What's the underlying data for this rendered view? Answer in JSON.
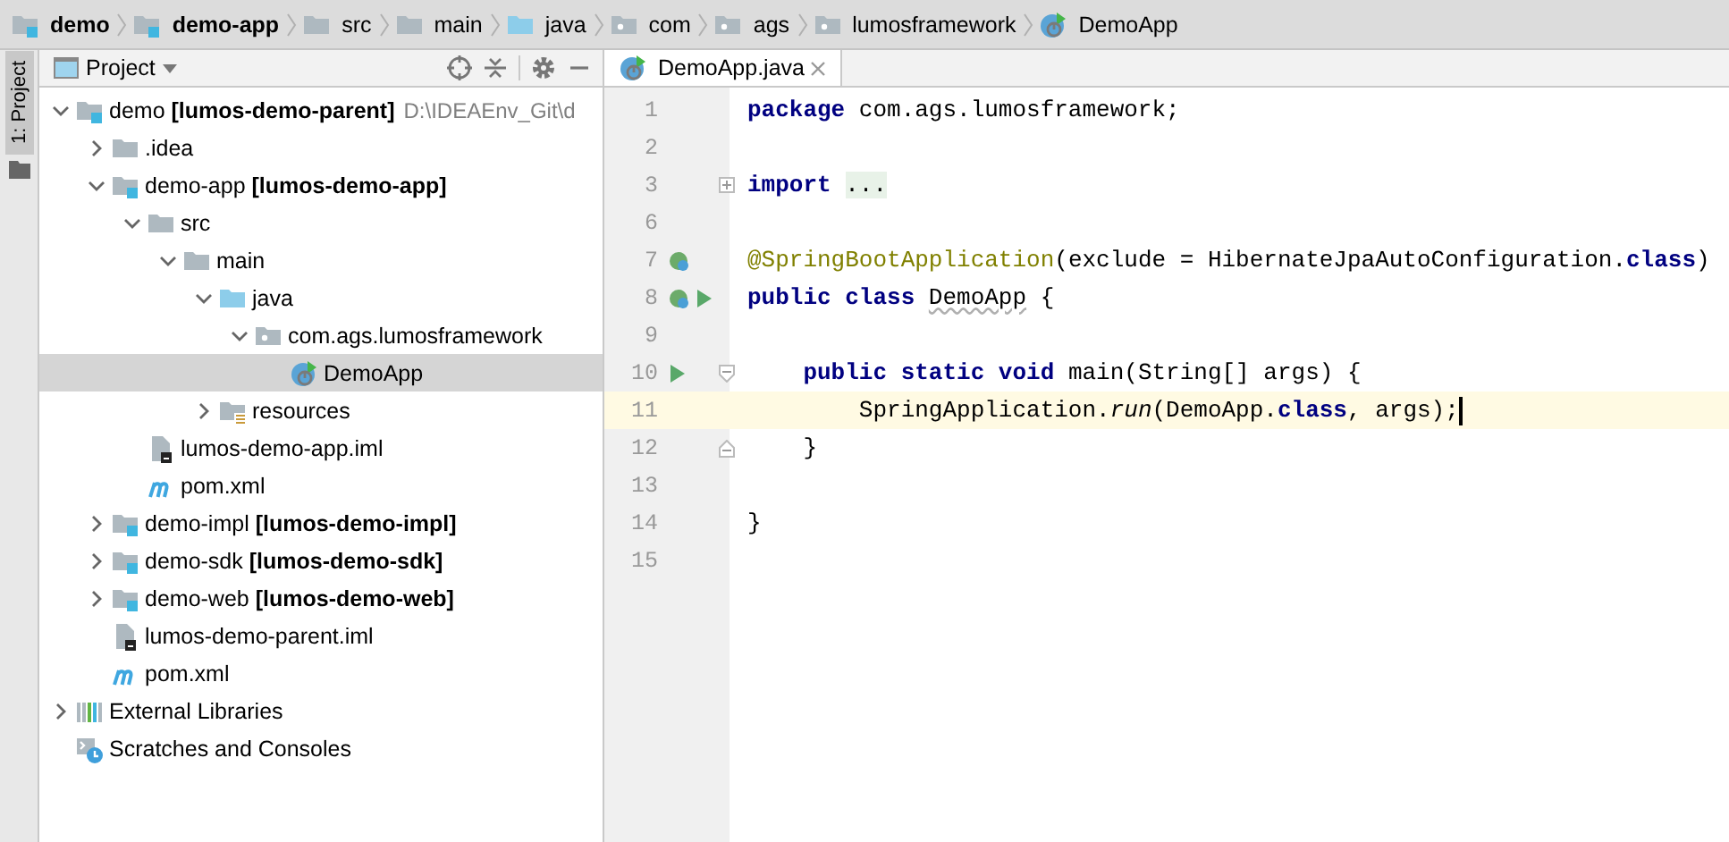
{
  "breadcrumbs": [
    {
      "label": "demo",
      "kind": "module",
      "bold": true
    },
    {
      "label": "demo-app",
      "kind": "module",
      "bold": true
    },
    {
      "label": "src",
      "kind": "folder",
      "bold": false
    },
    {
      "label": "main",
      "kind": "folder",
      "bold": false
    },
    {
      "label": "java",
      "kind": "source-folder",
      "bold": false
    },
    {
      "label": "com",
      "kind": "package",
      "bold": false
    },
    {
      "label": "ags",
      "kind": "package",
      "bold": false
    },
    {
      "label": "lumosframework",
      "kind": "package",
      "bold": false
    },
    {
      "label": "DemoApp",
      "kind": "spring-class",
      "bold": false
    }
  ],
  "side_strip": {
    "label": "1: Project",
    "selected": true
  },
  "project_panel": {
    "title": "Project",
    "tree": [
      {
        "label": "demo **[lumos-demo-parent]**",
        "hint": "D:\\IDEAEnv_Git\\d",
        "kind": "module",
        "expanded": true,
        "selected": false,
        "children": [
          {
            "label": ".idea",
            "kind": "folder",
            "expanded": false,
            "selected": false
          },
          {
            "label": "demo-app **[lumos-demo-app]**",
            "kind": "module",
            "expanded": true,
            "selected": false,
            "children": [
              {
                "label": "src",
                "kind": "folder",
                "expanded": true,
                "selected": false,
                "children": [
                  {
                    "label": "main",
                    "kind": "folder",
                    "expanded": true,
                    "selected": false,
                    "children": [
                      {
                        "label": "java",
                        "kind": "source-folder",
                        "expanded": true,
                        "selected": false,
                        "children": [
                          {
                            "label": "com.ags.lumosframework",
                            "kind": "package",
                            "expanded": true,
                            "selected": false,
                            "children": [
                              {
                                "label": "DemoApp",
                                "kind": "spring-class",
                                "selected": true
                              }
                            ]
                          }
                        ]
                      },
                      {
                        "label": "resources",
                        "kind": "resources-folder",
                        "expanded": false,
                        "selected": false
                      }
                    ]
                  }
                ]
              },
              {
                "label": "lumos-demo-app.iml",
                "kind": "iml-file",
                "selected": false
              },
              {
                "label": "pom.xml",
                "kind": "maven",
                "selected": false
              }
            ]
          },
          {
            "label": "demo-impl **[lumos-demo-impl]**",
            "kind": "module",
            "expanded": false,
            "selected": false
          },
          {
            "label": "demo-sdk **[lumos-demo-sdk]**",
            "kind": "module",
            "expanded": false,
            "selected": false
          },
          {
            "label": "demo-web **[lumos-demo-web]**",
            "kind": "module",
            "expanded": false,
            "selected": false
          },
          {
            "label": "lumos-demo-parent.iml",
            "kind": "iml-file",
            "selected": false
          },
          {
            "label": "pom.xml",
            "kind": "maven",
            "selected": false
          }
        ]
      },
      {
        "label": "External Libraries",
        "kind": "libraries",
        "expanded": false,
        "selected": false
      },
      {
        "label": "Scratches and Consoles",
        "kind": "scratches",
        "selected": false
      }
    ]
  },
  "editor": {
    "tabs": [
      {
        "label": "DemoApp.java",
        "selected": true
      }
    ],
    "lines": [
      {
        "number": "1",
        "current": false,
        "caret": false,
        "tokens": [
          {
            "text": "package",
            "kind": "keyword"
          },
          {
            "text": " com.ags.lumosframework;",
            "kind": "plain"
          }
        ]
      },
      {
        "number": "2",
        "current": false,
        "caret": false
      },
      {
        "number": "3",
        "current": false,
        "caret": false,
        "fold": {
          "kind": "collapsed"
        },
        "tokens": [
          {
            "text": "import ",
            "kind": "keyword"
          },
          {
            "text": "...",
            "kind": "folded"
          }
        ]
      },
      {
        "number": "6",
        "current": false,
        "caret": false
      },
      {
        "number": "7",
        "current": false,
        "caret": false,
        "gutter": [
          {
            "kind": "bean"
          }
        ],
        "tokens": [
          {
            "text": "@SpringBootApplication",
            "kind": "annotation"
          },
          {
            "text": "(exclude = HibernateJpaAutoConfiguration.",
            "kind": "plain"
          },
          {
            "text": "class",
            "kind": "keyword"
          },
          {
            "text": ")",
            "kind": "plain"
          }
        ]
      },
      {
        "number": "8",
        "current": false,
        "caret": false,
        "gutter": [
          {
            "kind": "bean"
          },
          {
            "kind": "run"
          }
        ],
        "tokens": [
          {
            "text": "public class ",
            "kind": "keyword"
          },
          {
            "text": "DemoApp",
            "kind": "unused"
          },
          {
            "text": " {",
            "kind": "plain"
          }
        ]
      },
      {
        "number": "9",
        "current": false,
        "caret": false
      },
      {
        "number": "10",
        "current": false,
        "caret": false,
        "gutter": [
          {
            "kind": "run"
          }
        ],
        "fold": {
          "kind": "start"
        },
        "tokens": [
          {
            "text": "    public static void",
            "kind": "keyword"
          },
          {
            "text": " main(String[] args) {",
            "kind": "plain"
          }
        ]
      },
      {
        "number": "11",
        "current": true,
        "caret": true,
        "tokens": [
          {
            "text": "        SpringApplication.",
            "kind": "plain"
          },
          {
            "text": "run",
            "kind": "static-call"
          },
          {
            "text": "(DemoApp.",
            "kind": "plain"
          },
          {
            "text": "class",
            "kind": "keyword"
          },
          {
            "text": ", args);",
            "kind": "plain"
          }
        ]
      },
      {
        "number": "12",
        "current": false,
        "caret": false,
        "fold": {
          "kind": "end"
        },
        "tokens": [
          {
            "text": "    }",
            "kind": "plain"
          }
        ]
      },
      {
        "number": "13",
        "current": false,
        "caret": false
      },
      {
        "number": "14",
        "current": false,
        "caret": false,
        "tokens": [
          {
            "text": "}",
            "kind": "plain"
          }
        ]
      },
      {
        "number": "15",
        "current": false,
        "caret": false
      }
    ]
  }
}
